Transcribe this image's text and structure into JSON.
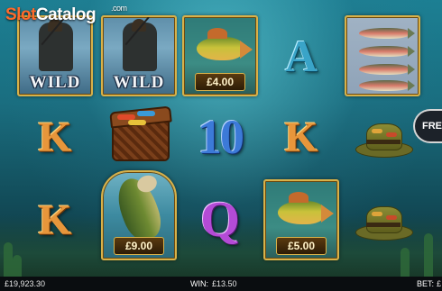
{
  "logo": {
    "slot": "Slot",
    "catalog": "Catalog",
    "com": ".com"
  },
  "reels": {
    "r1": {
      "wild1": "WILD",
      "k1": "K",
      "k2": "K"
    },
    "r2": {
      "wild2": "WILD",
      "bass_price": "£9.00"
    },
    "r3": {
      "perch_price": "£4.00",
      "ten": "10",
      "q": "Q"
    },
    "r4": {
      "a": "A",
      "k": "K",
      "perch_price": "£5.00"
    },
    "r5": {}
  },
  "side_button": {
    "label": "FRE"
  },
  "status": {
    "balance_value": "£19,923.30",
    "win_label": "WIN:",
    "win_value": "£13.50",
    "bet_label": "BET:",
    "bet_value": "£"
  },
  "colors": {
    "frame_gold": "#d8b149",
    "k_orange": "#e7963b",
    "a_teal": "#3aa4c8",
    "ten_blue": "#3c7ad8",
    "q_purple": "#b44bd6"
  }
}
